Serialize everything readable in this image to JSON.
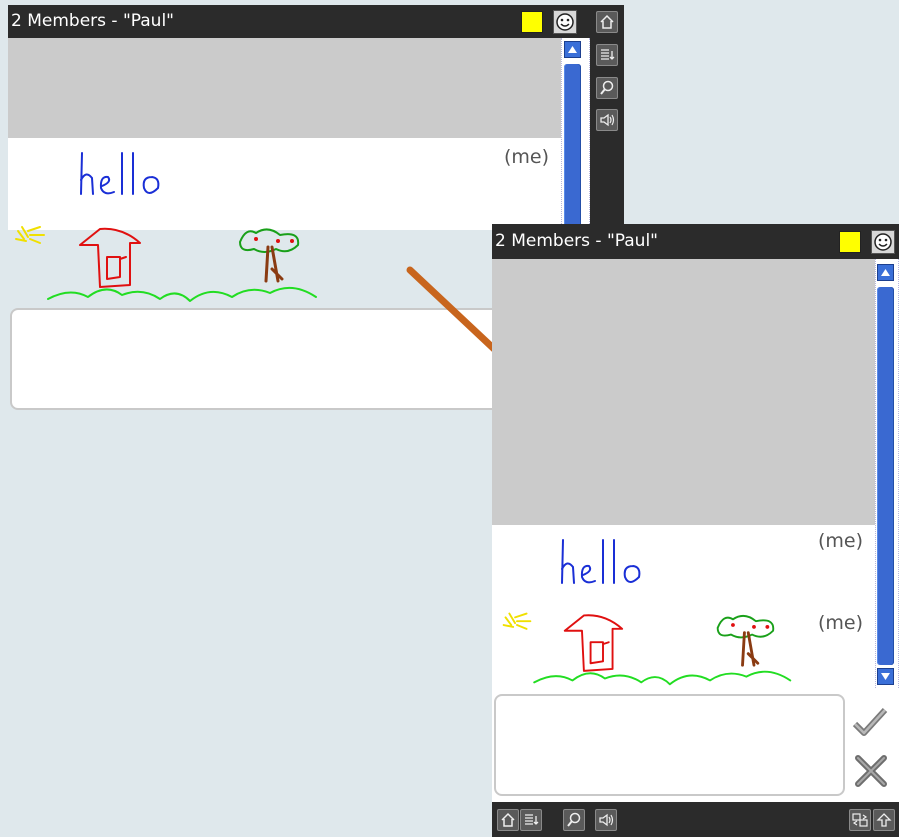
{
  "window1": {
    "title": "2 Members - \"Paul\"",
    "swatch_color": "#ffff00",
    "messages": [
      {
        "sender": "(me)",
        "text": "hello"
      }
    ]
  },
  "window2": {
    "title": "2 Members - \"Paul\"",
    "swatch_color": "#ffff00",
    "messages": [
      {
        "sender": "(me)",
        "text": "hello"
      },
      {
        "sender": "(me)",
        "drawing": "doodle-house-tree-sun"
      }
    ]
  },
  "icons": {
    "home": "home-icon",
    "list": "list-icon",
    "search": "search-icon",
    "sound": "sound-icon",
    "smiley": "smiley-icon",
    "send": "check-icon",
    "clear": "clear-icon",
    "swap": "swap-icon",
    "up": "up-arrow-icon"
  },
  "colors": {
    "titlebar": "#2b2b2b",
    "accent_scroll": "#3a6fd8",
    "handwriting": "#1a2fd6",
    "arrow": "#c8651d"
  }
}
